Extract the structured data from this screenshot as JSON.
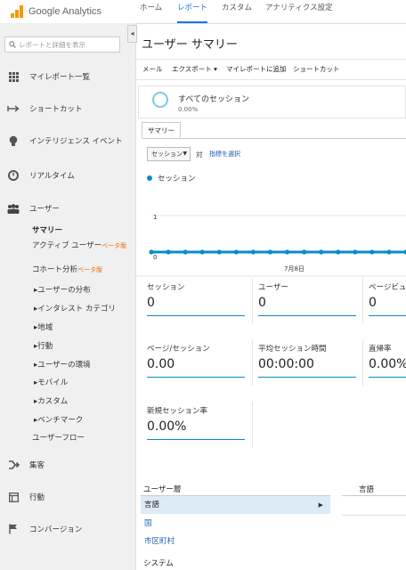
{
  "app": {
    "name": "Google Analytics"
  },
  "top_nav": [
    "ホーム",
    "レポート",
    "カスタム",
    "アナリティクス設定"
  ],
  "search": {
    "placeholder": "レポートと詳細を表示"
  },
  "sidebar": {
    "items": [
      {
        "label": "マイレポート一覧",
        "icon": "grid-icon"
      },
      {
        "label": "ショートカット",
        "icon": "shortcut-arrow-icon"
      },
      {
        "label": "インテリジェンス イベント",
        "icon": "lightbulb-icon"
      },
      {
        "label": "リアルタイム",
        "icon": "clock-icon"
      },
      {
        "label": "ユーザー",
        "icon": "users-icon"
      }
    ],
    "audience_sub": {
      "summary": "サマリー",
      "active_users": "アクティブ ユーザー",
      "active_beta": "ベータ版",
      "cohort": "コホート分析",
      "cohort_beta": "ベータ版",
      "nested": [
        "ユーザーの分布",
        "インタレスト カテゴリ",
        "地域",
        "行動",
        "ユーザーの環境",
        "モバイル",
        "カスタム",
        "ベンチマーク"
      ],
      "user_flow": "ユーザーフロー"
    },
    "bottom_items": [
      {
        "label": "集客",
        "icon": "acquisition-icon"
      },
      {
        "label": "行動",
        "icon": "behavior-icon"
      },
      {
        "label": "コンバージョン",
        "icon": "flag-icon"
      }
    ]
  },
  "main": {
    "title": "ユーザー サマリー",
    "toolbar": [
      "メール",
      "エクスポート ▾",
      "マイレポートに追加",
      "ショートカット"
    ],
    "segment": {
      "name": "すべてのセッション",
      "percent": "0.00%"
    },
    "tab": "サマリー",
    "metric_select": "セッション",
    "vs": "対",
    "choose_metric": "指標を選択",
    "legend": "セッション"
  },
  "chart_data": {
    "type": "line",
    "series": [
      {
        "name": "セッション",
        "values": [
          0,
          0,
          0,
          0,
          0,
          0,
          0,
          0,
          0,
          0,
          0,
          0,
          0,
          0,
          0,
          0,
          0,
          0,
          0,
          0,
          0,
          0,
          0,
          0,
          0,
          0,
          0,
          0,
          0,
          0,
          0
        ]
      }
    ],
    "ylim": [
      0,
      1
    ],
    "y_ticks": [
      "1",
      "0"
    ],
    "x_tick_label": "7月8日",
    "color": "#058dc7"
  },
  "metrics": [
    {
      "label": "セッション",
      "value": "0"
    },
    {
      "label": "ユーザー",
      "value": "0"
    },
    {
      "label": "ページビュー数",
      "value": "0"
    },
    {
      "label": "ページ/セッション",
      "value": "0.00"
    },
    {
      "label": "平均セッション時間",
      "value": "00:00:00"
    },
    {
      "label": "直帰率",
      "value": "0.00%"
    },
    {
      "label": "新規セッション率",
      "value": "0.00%"
    }
  ],
  "bottom": {
    "left_header": "ユーザー層",
    "right_header": "言語",
    "rows": [
      "言語",
      "国",
      "市区町村"
    ],
    "system_header": "システム"
  }
}
